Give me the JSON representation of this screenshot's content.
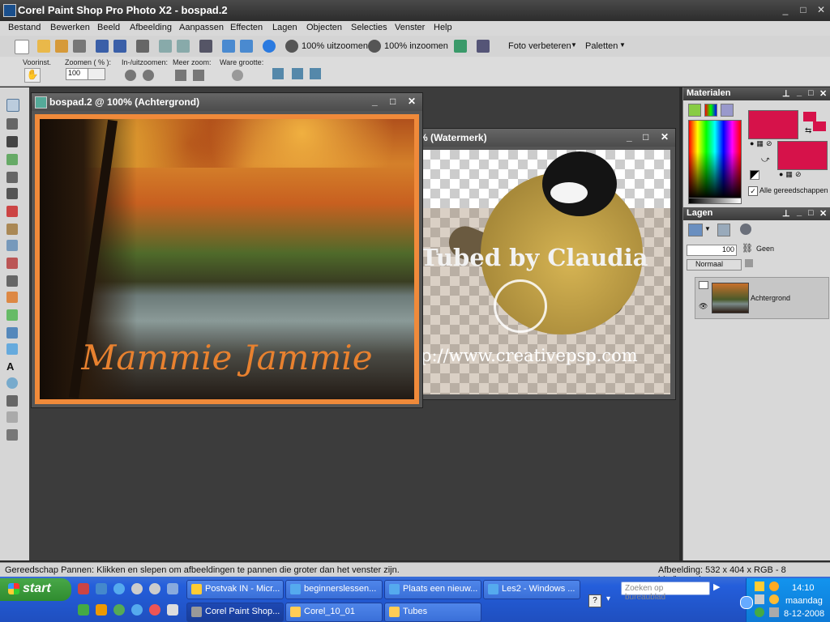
{
  "app": {
    "title": "Corel Paint Shop Pro Photo X2 - bospad.2"
  },
  "window_controls": {
    "min": "_",
    "max": "□",
    "close": "✕"
  },
  "menu": [
    "Bestand",
    "Bewerken",
    "Beeld",
    "Afbeelding",
    "Aanpassen",
    "Effecten",
    "Lagen",
    "Objecten",
    "Selecties",
    "Venster",
    "Help"
  ],
  "toolbar": {
    "zoom_out_label": "100% uitzoomen",
    "zoom_in_label": "100% inzoomen",
    "photo_enhance_label": "Foto verbeteren",
    "palettes_label": "Paletten"
  },
  "options": {
    "presets_label": "Voorinst.",
    "zoom_label": "Zoomen ( % ):",
    "zoom_value": "100",
    "inout_label": "In-/uitzoomen:",
    "more_zoom_label": "Meer zoom:",
    "actual_size_label": "Ware grootte:"
  },
  "doc1": {
    "title": "bospad.2 @ 100% (Achtergrond)",
    "watermark_text": "Mammie Jammie"
  },
  "doc2": {
    "title": "% (Watermerk)",
    "tubed_text": "Tubed by Claudia",
    "url_text": "p://www.creativepsp.com"
  },
  "materials": {
    "header": "Materialen",
    "all_tools_label": "Alle gereedschappen",
    "fg_color": "#d6124a",
    "bg_color": "#d6124a"
  },
  "layers": {
    "header": "Lagen",
    "opacity_value": "100",
    "none_label": "Geen",
    "blend_mode": "Normaal",
    "layer_name": "Achtergrond"
  },
  "status": {
    "left": "Gereedschap Pannen: Klikken en slepen om afbeeldingen te pannen die groter dan het venster zijn.",
    "right": "Afbeelding:  532 x 404 x RGB - 8 bits/kanaal"
  },
  "taskbar": {
    "start_label": "start",
    "search_placeholder": "Zoeken op bureaublad",
    "row1": [
      "Postvak IN - Micr...",
      "beginnerslessen...",
      "Plaats een nieuw...",
      "Les2 - Windows ..."
    ],
    "row2": [
      "Corel Paint Shop...",
      "Corel_10_01",
      "Tubes"
    ],
    "clock_time": "14:10",
    "clock_day": "maandag",
    "clock_date": "8-12-2008"
  }
}
